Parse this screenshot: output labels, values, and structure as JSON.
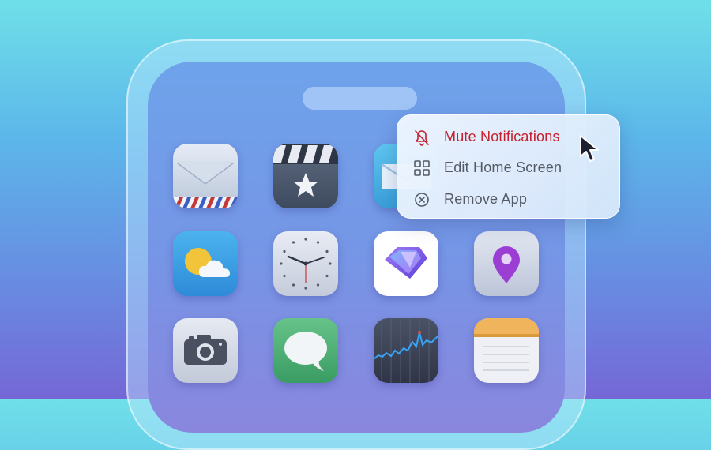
{
  "context_menu": {
    "items": [
      {
        "label": "Mute Notifications",
        "icon": "bell-slash-icon",
        "color": "#c61f2b"
      },
      {
        "label": "Edit Home Screen",
        "icon": "grid-icon",
        "color": "#555b66"
      },
      {
        "label": "Remove App",
        "icon": "x-circle-icon",
        "color": "#555b66"
      }
    ]
  },
  "apps": [
    {
      "name": "mail",
      "icon": "envelope-icon"
    },
    {
      "name": "videos",
      "icon": "clapperboard-icon"
    },
    {
      "name": "messages-mail",
      "icon": "envelope-icon"
    },
    {
      "name": "weather",
      "icon": "sun-cloud-icon"
    },
    {
      "name": "clock",
      "icon": "clock-icon"
    },
    {
      "name": "featured-app",
      "icon": "gem-icon"
    },
    {
      "name": "maps",
      "icon": "location-pin-icon"
    },
    {
      "name": "camera",
      "icon": "camera-icon"
    },
    {
      "name": "messages",
      "icon": "speech-bubble-icon"
    },
    {
      "name": "stocks",
      "icon": "stock-chart-icon"
    },
    {
      "name": "notes",
      "icon": "notepad-icon"
    }
  ],
  "colors": {
    "accent_red": "#c61f2b",
    "menu_text": "#555b66"
  }
}
